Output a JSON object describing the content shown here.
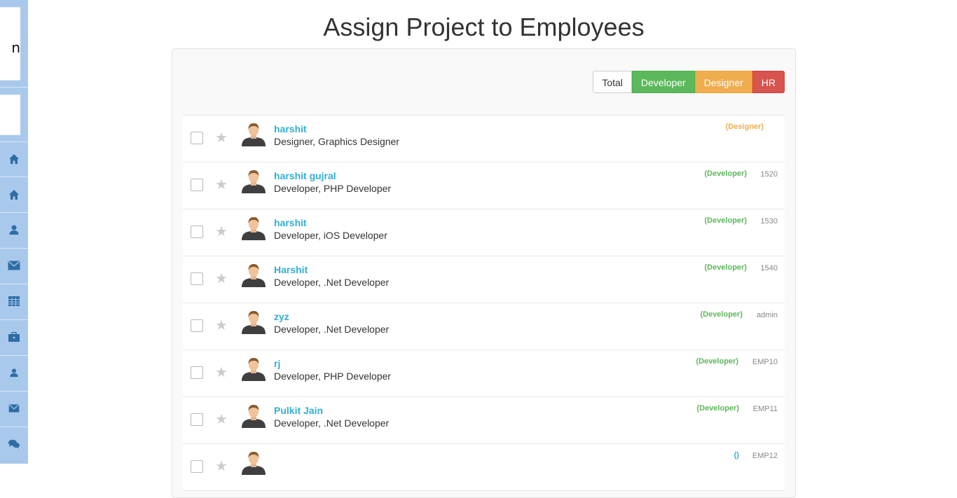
{
  "sidebar": {
    "logo_text": "n",
    "items": [
      {
        "icon": "home-icon"
      },
      {
        "icon": "home-icon"
      },
      {
        "icon": "user-icon"
      },
      {
        "icon": "envelope-icon"
      },
      {
        "icon": "table-icon"
      },
      {
        "icon": "briefcase-icon"
      },
      {
        "icon": "user-icon"
      },
      {
        "icon": "envelope-icon"
      },
      {
        "icon": "chat-icon"
      }
    ],
    "color": "#a9c9ec",
    "icon_color": "#2e6da4"
  },
  "page": {
    "title": "Assign Project to Employees"
  },
  "filters": {
    "total": "Total",
    "developer": "Developer",
    "designer": "Designer",
    "hr": "HR"
  },
  "employees": [
    {
      "name": "harshit",
      "role": "Designer, Graphics Designer",
      "type": "(Designer)",
      "id": ""
    },
    {
      "name": "harshit gujral",
      "role": "Developer, PHP Developer",
      "type": "(Developer)",
      "id": "1520"
    },
    {
      "name": "harshit",
      "role": "Developer, iOS Developer",
      "type": "(Developer)",
      "id": "1530"
    },
    {
      "name": "Harshit",
      "role": "Developer, .Net Developer",
      "type": "(Developer)",
      "id": "1540"
    },
    {
      "name": "zyz",
      "role": "Developer, .Net Developer",
      "type": "(Developer)",
      "id": "admin"
    },
    {
      "name": "rj",
      "role": "Developer, PHP Developer",
      "type": "(Developer)",
      "id": "EMP10"
    },
    {
      "name": "Pulkit Jain",
      "role": "Developer, .Net Developer",
      "type": "(Developer)",
      "id": "EMP11"
    },
    {
      "name": "",
      "role": "",
      "type": "()",
      "id": "EMP12"
    }
  ]
}
